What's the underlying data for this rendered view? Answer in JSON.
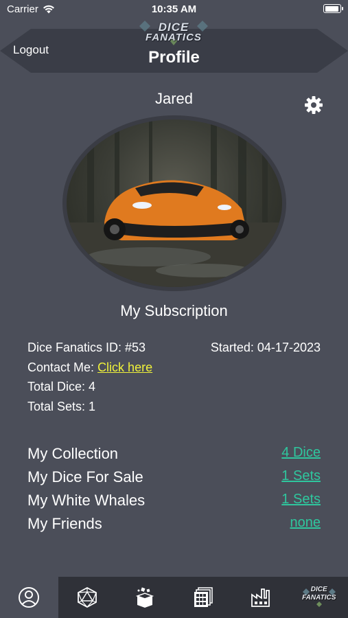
{
  "status_bar": {
    "carrier": "Carrier",
    "time": "10:35 AM"
  },
  "header": {
    "logout_label": "Logout",
    "title": "Profile",
    "logo_line1": "DICE",
    "logo_line2": "FANATICS"
  },
  "profile": {
    "username": "Jared"
  },
  "subscription": {
    "title": "My Subscription",
    "id_text": "Dice Fanatics ID: #53",
    "started_text": "Started: 04-17-2023",
    "contact_label": "Contact Me:",
    "contact_link": "Click here",
    "total_dice": "Total Dice: 4",
    "total_sets": "Total Sets: 1"
  },
  "rows": [
    {
      "label": "My Collection",
      "value": "4 Dice"
    },
    {
      "label": "My Dice For Sale",
      "value": "1 Sets"
    },
    {
      "label": "My White Whales",
      "value": "1 Sets"
    },
    {
      "label": "My Friends",
      "value": "none"
    }
  ],
  "tabbar": {
    "items": [
      "profile-icon",
      "d20-dice-icon",
      "dice-box-icon",
      "sets-grid-icon",
      "factory-icon",
      "dice-fanatics-logo-icon"
    ],
    "logo_line1": "DICE",
    "logo_line2": "FANATICS"
  },
  "colors": {
    "background": "#4b4e59",
    "banner": "#3a3d47",
    "tabbar": "#2f3138",
    "link_green": "#2fc79e",
    "link_yellow": "#f0f23a"
  }
}
